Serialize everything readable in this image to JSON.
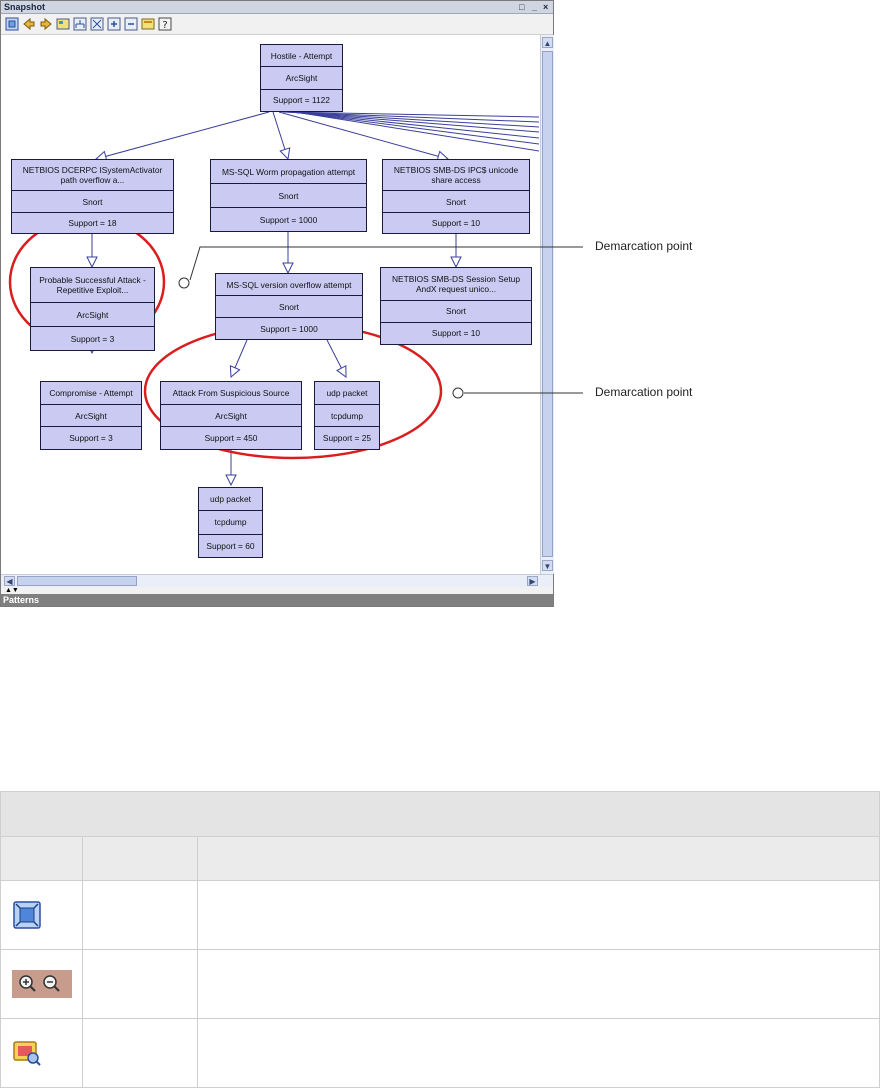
{
  "window": {
    "title": "Snapshot",
    "controls": [
      "restore",
      "minimize",
      "close"
    ],
    "bottom_panel_label": "Patterns",
    "toolbar_icons": [
      "fit-to-window-icon",
      "back-icon",
      "forward-icon",
      "layout-icon",
      "tree-layout-icon",
      "expand-icon",
      "zoom-in-icon",
      "zoom-out-icon",
      "settings-icon",
      "help-icon"
    ]
  },
  "graph": {
    "nodes": [
      {
        "id": "hostile",
        "title": "Hostile - Attempt",
        "source": "ArcSight",
        "support": "Support = 1122"
      },
      {
        "id": "netbios-dcerpc",
        "title": "NETBIOS DCERPC ISystemActivator path overflow a...",
        "source": "Snort",
        "support": "Support = 18"
      },
      {
        "id": "mssql-worm",
        "title": "MS-SQL Worm propagation attempt",
        "source": "Snort",
        "support": "Support = 1000"
      },
      {
        "id": "netbios-smb-ipc",
        "title": "NETBIOS SMB-DS IPC$ unicode share access",
        "source": "Snort",
        "support": "Support = 10"
      },
      {
        "id": "probable-attack",
        "title": "Probable Successful Attack - Repetitive Exploit...",
        "source": "ArcSight",
        "support": "Support = 3"
      },
      {
        "id": "mssql-version",
        "title": "MS-SQL version overflow attempt",
        "source": "Snort",
        "support": "Support = 1000"
      },
      {
        "id": "netbios-smb-session",
        "title": "NETBIOS SMB-DS Session Setup AndX request unico...",
        "source": "Snort",
        "support": "Support = 10"
      },
      {
        "id": "compromise",
        "title": "Compromise - Attempt",
        "source": "ArcSight",
        "support": "Support = 3"
      },
      {
        "id": "attack-suspicious",
        "title": "Attack From Suspicious Source",
        "source": "ArcSight",
        "support": "Support = 450"
      },
      {
        "id": "udp-25",
        "title": "udp packet",
        "source": "tcpdump",
        "support": "Support = 25"
      },
      {
        "id": "udp-60",
        "title": "udp packet",
        "source": "tcpdump",
        "support": "Support = 60"
      }
    ]
  },
  "callouts": [
    {
      "label": "Demarcation point"
    },
    {
      "label": "Demarcation point"
    }
  ],
  "legend_table": {
    "caption": "",
    "headers": [
      "",
      "",
      ""
    ],
    "rows": [
      {
        "icon": "fit-to-window-icon",
        "name": "",
        "description": ""
      },
      {
        "icon": "zoom-in-zoom-out-icons",
        "name": "",
        "description": ""
      },
      {
        "icon": "snapshot-settings-icon",
        "name": "",
        "description": ""
      }
    ]
  },
  "colors": {
    "node_fill": "#cbcaf3",
    "node_border": "#1a1a40",
    "edge": "#3a3f9a",
    "highlight_ellipse": "#d81e1e"
  }
}
